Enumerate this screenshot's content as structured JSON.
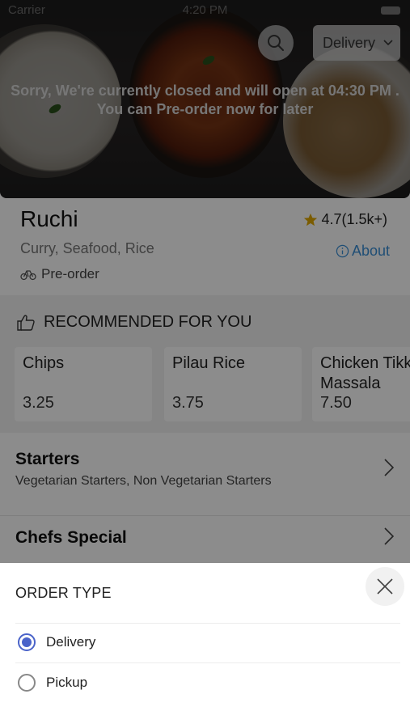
{
  "status_bar": {
    "carrier": "Carrier",
    "time": "4:20 PM"
  },
  "hero": {
    "closed_line1": "Sorry, We're currently closed and will open at 04:30 PM .",
    "closed_line2": "You can Pre-order now for later",
    "order_type_button": "Delivery"
  },
  "restaurant": {
    "name": "Ruchi",
    "rating": "4.7(1.5k+)",
    "cuisine": "Curry, Seafood, Rice",
    "about_label": "About",
    "preorder_label": "Pre-order"
  },
  "recommended": {
    "heading": "RECOMMENDED FOR YOU",
    "items": [
      {
        "name": "Chips",
        "price": "3.25"
      },
      {
        "name": "Pilau Rice",
        "price": "3.75"
      },
      {
        "name": "Chicken Tikka",
        "name_line2": "Massala",
        "price": "7.50"
      }
    ]
  },
  "categories": [
    {
      "title": "Starters",
      "subtitle": "Vegetarian Starters, Non Vegetarian Starters"
    },
    {
      "title": "Chefs Special",
      "subtitle": ""
    }
  ],
  "order_sheet": {
    "title": "ORDER TYPE",
    "options": [
      {
        "label": "Delivery",
        "selected": true
      },
      {
        "label": "Pickup",
        "selected": false
      }
    ]
  },
  "colors": {
    "accent": "#4a63c9",
    "link": "#3a8fd6",
    "star": "#e0a800"
  },
  "icons": [
    "search-icon",
    "chevron-down-icon",
    "star-icon",
    "info-icon",
    "bike-icon",
    "thumbs-up-icon",
    "chevron-right-icon",
    "close-icon"
  ]
}
